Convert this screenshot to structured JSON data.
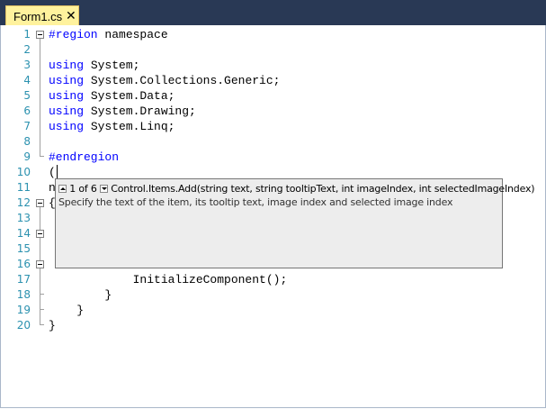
{
  "tab": {
    "title": "Form1.cs",
    "close_glyph": "✕",
    "background": "#fff29d"
  },
  "titlebar": {
    "background": "#293955"
  },
  "editor": {
    "line_numbers": [
      "1",
      "2",
      "3",
      "4",
      "5",
      "6",
      "7",
      "8",
      "9",
      "10",
      "11",
      "12",
      "13",
      "14",
      "15",
      "16",
      "17",
      "18",
      "19",
      "20"
    ],
    "lines": [
      {
        "kw": "#region",
        "text": " namespace"
      },
      {
        "kw": "",
        "text": ""
      },
      {
        "kw": "using",
        "text": " System;"
      },
      {
        "kw": "using",
        "text": " System.Collections.Generic;"
      },
      {
        "kw": "using",
        "text": " System.Data;"
      },
      {
        "kw": "using",
        "text": " System.Drawing;"
      },
      {
        "kw": "using",
        "text": " System.Linq;"
      },
      {
        "kw": "",
        "text": ""
      },
      {
        "kw": "#endregion",
        "text": ""
      },
      {
        "kw": "",
        "text": "("
      },
      {
        "kw": "",
        "text": "n"
      },
      {
        "kw": "",
        "text": "{"
      },
      {
        "kw": "",
        "text": ""
      },
      {
        "kw": "",
        "text": ""
      },
      {
        "kw": "",
        "text": ""
      },
      {
        "kw": "",
        "text": ""
      },
      {
        "kw": "",
        "text": "            InitializeComponent();"
      },
      {
        "kw": "",
        "text": "        }"
      },
      {
        "kw": "",
        "text": "    }"
      },
      {
        "kw": "",
        "text": "}"
      }
    ],
    "keyword_color": "#0000ff",
    "line_number_color": "#2b91af"
  },
  "tooltip": {
    "overload_counter": "1 of 6",
    "signature": "Control.Items.Add(string text, string tooltipText, int imageIndex, int selectedImageIndex)",
    "description": "Specify the text of the item, its tooltip text, image index and selected image index"
  }
}
